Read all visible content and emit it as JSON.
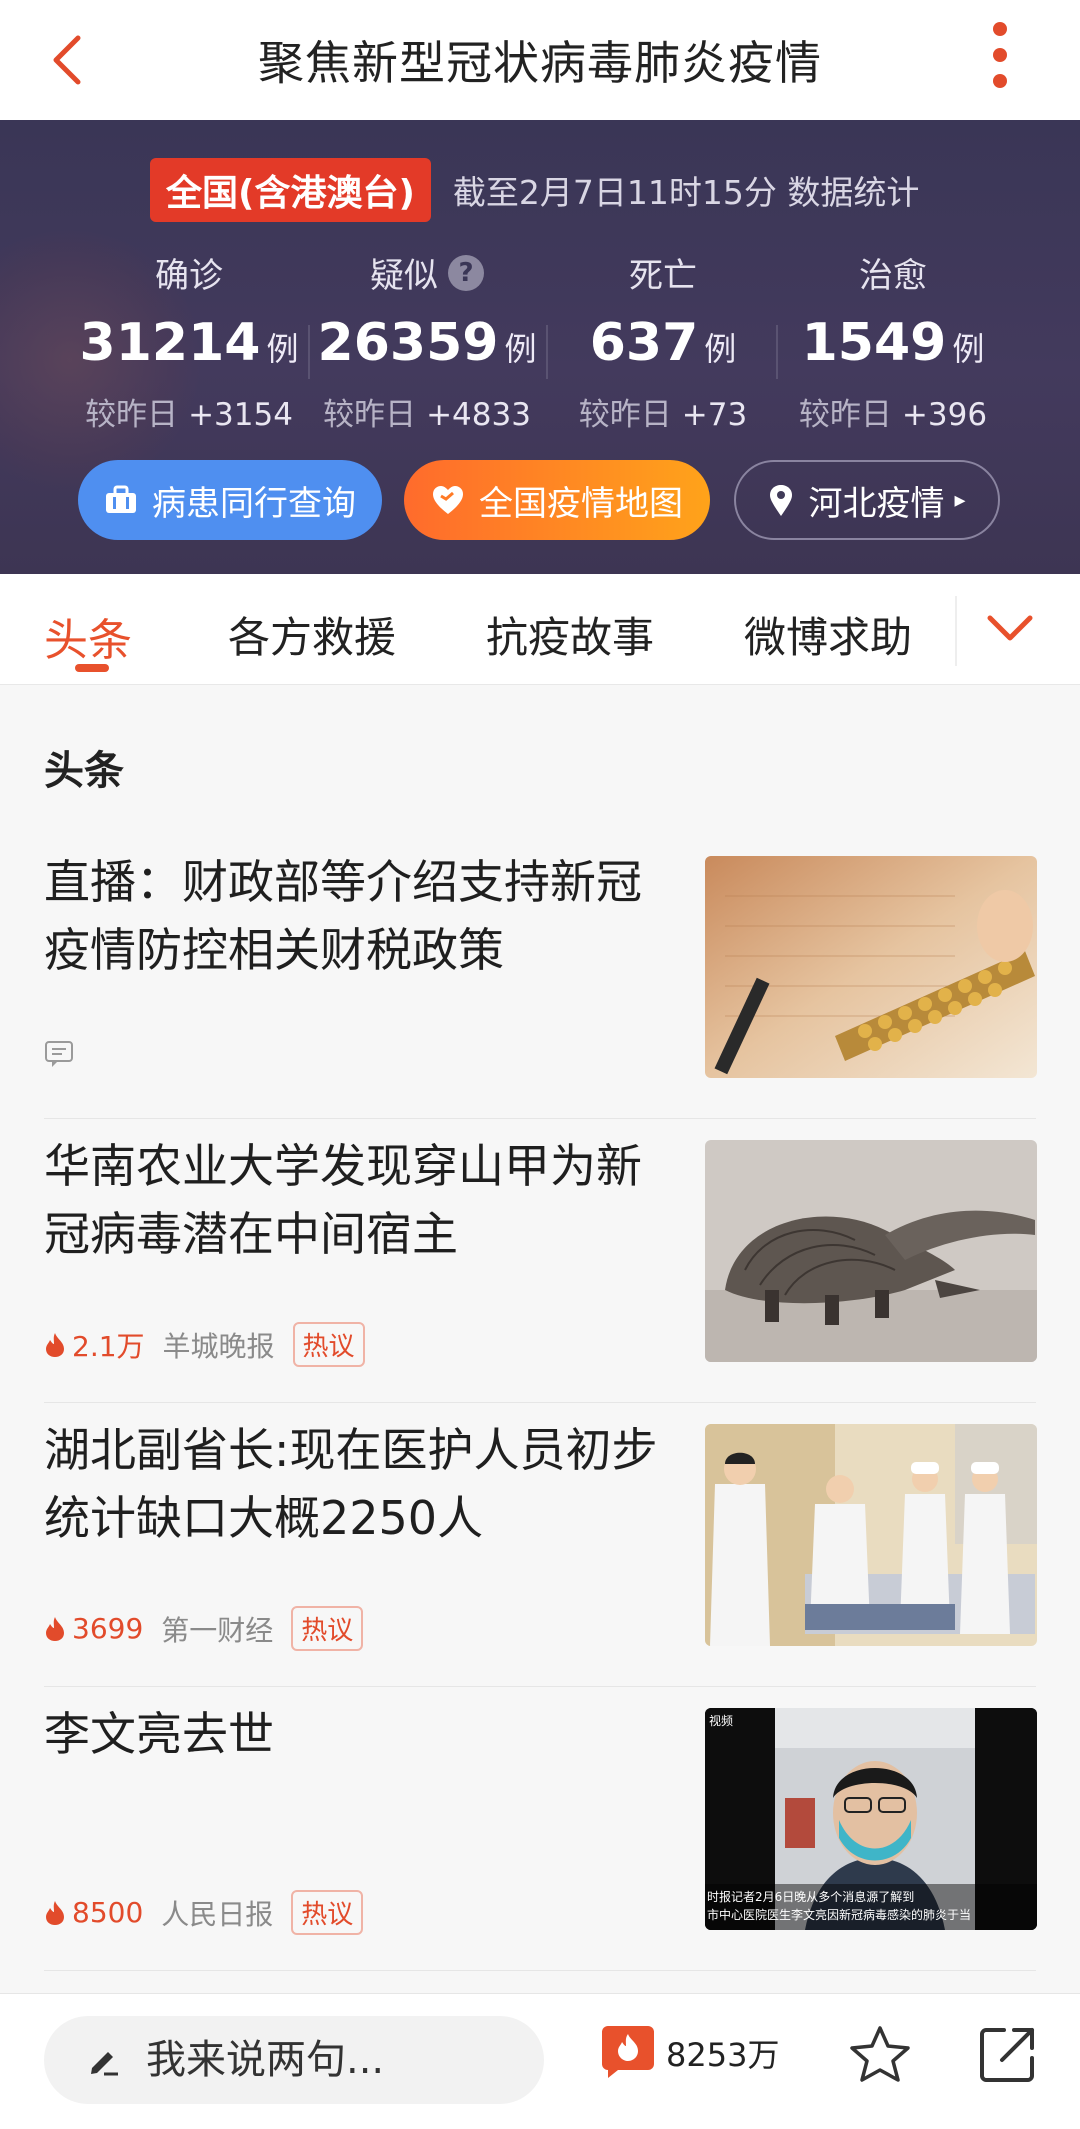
{
  "header": {
    "title": "聚焦新型冠状病毒肺炎疫情",
    "back_icon": "back-arrow-icon",
    "more_icon": "more-vertical-icon"
  },
  "scope": {
    "badge": "全国(含港澳台)",
    "timestamp": "截至2月7日11时15分 数据统计"
  },
  "metrics": [
    {
      "label": "确诊",
      "value": "31214",
      "unit": "例",
      "delta_label": "较昨日",
      "delta": "+3154"
    },
    {
      "label": "疑似",
      "value": "26359",
      "unit": "例",
      "delta_label": "较昨日",
      "delta": "+4833",
      "help_glyph": "?"
    },
    {
      "label": "死亡",
      "value": "637",
      "unit": "例",
      "delta_label": "较昨日",
      "delta": "+73"
    },
    {
      "label": "治愈",
      "value": "1549",
      "unit": "例",
      "delta_label": "较昨日",
      "delta": "+396"
    }
  ],
  "actions": [
    {
      "label": "病患同行查询",
      "icon": "briefcase-icon",
      "color": "#4f8ff0"
    },
    {
      "label": "全国疫情地图",
      "icon": "map-heart-icon",
      "color": "#ff8a22"
    },
    {
      "label": "河北疫情",
      "icon": "location-pin-icon",
      "arrow": "▸"
    }
  ],
  "tabs": [
    "头条",
    "各方救援",
    "抗疫故事",
    "微博求助"
  ],
  "active_tab": "头条",
  "section": {
    "title": "头条"
  },
  "news": [
    {
      "headline": "直播：财政部等介绍支持新冠疫情防控相关财税政策",
      "hot": "",
      "source": "",
      "tag": "",
      "thumb": "abacus-photo"
    },
    {
      "headline": "华南农业大学发现穿山甲为新冠病毒潜在中间宿主",
      "hot": "2.1万",
      "source": "羊城晚报",
      "tag": "热议",
      "thumb": "pangolin-photo"
    },
    {
      "headline": "湖北副省长:现在医护人员初步统计缺口大概2250人",
      "hot": "3699",
      "source": "第一财经",
      "tag": "热议",
      "thumb": "medical-staff-photo"
    },
    {
      "headline": "李文亮去世",
      "hot": "8500",
      "source": "人民日报",
      "tag": "热议",
      "thumb": "video-doctor-photo",
      "thumb_badge": "视频",
      "caption_line1": "时报记者2月6日晚从多个消息源了解到",
      "caption_line2": "市中心医院医生李文亮因新冠病毒感染的肺炎于当"
    }
  ],
  "bottombar": {
    "comment_placeholder": "我来说两句...",
    "like_count": "8253万"
  },
  "colors": {
    "accent": "#e8512c",
    "panel": "#3d3756"
  }
}
